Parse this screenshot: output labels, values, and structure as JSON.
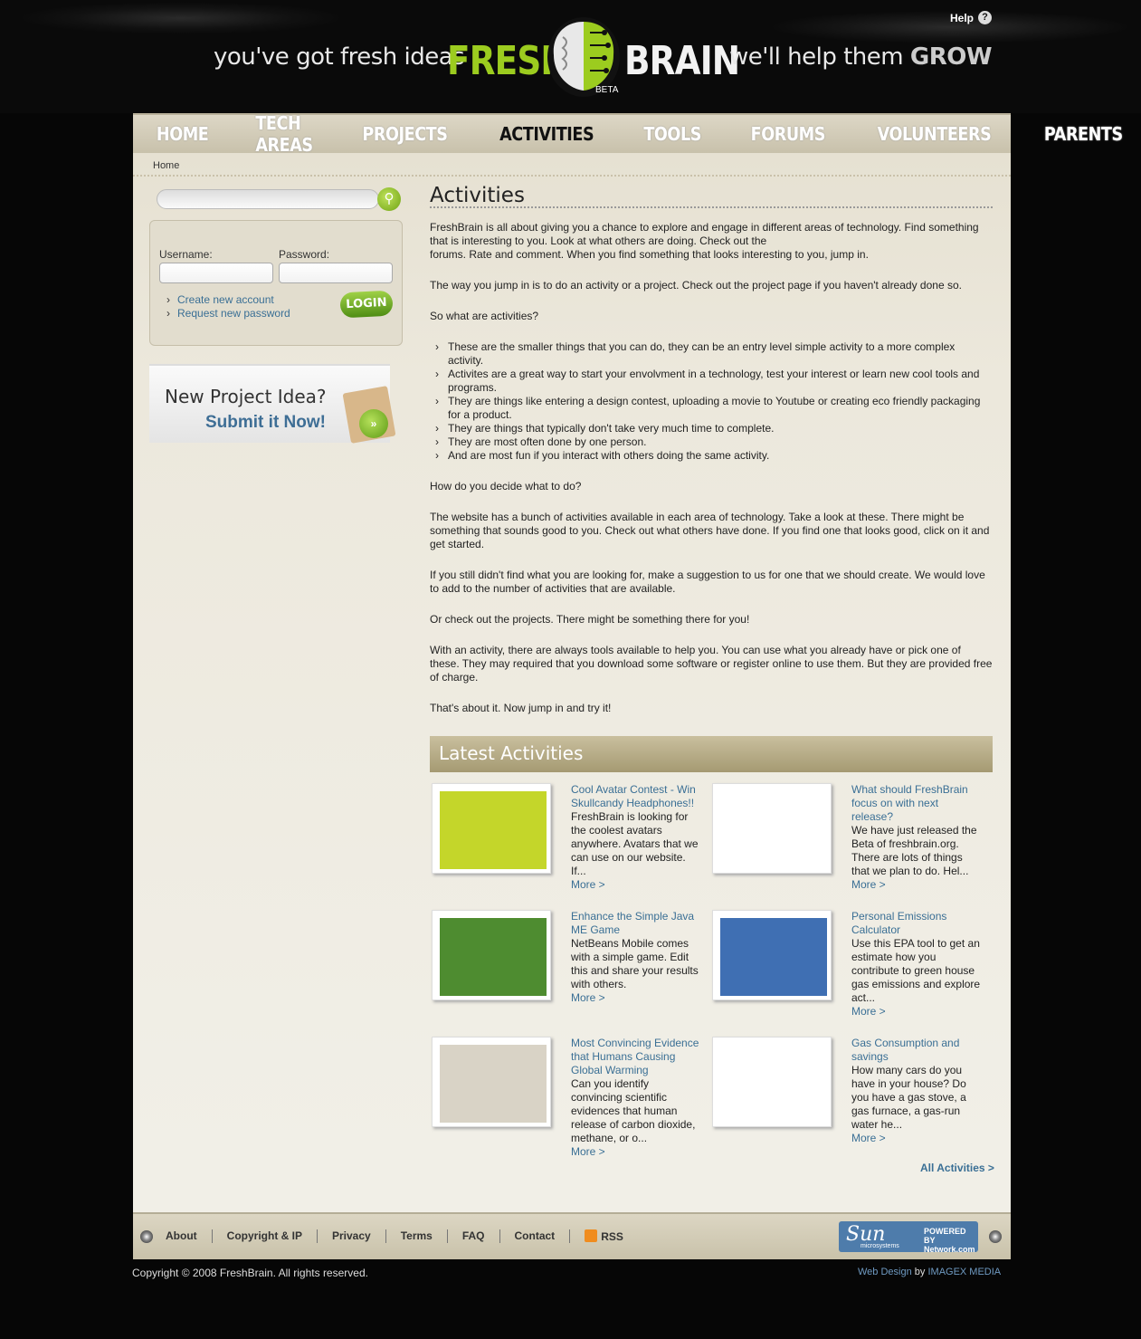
{
  "header": {
    "tagline_left": "you've got fresh ideas",
    "tagline_right": "we'll help them",
    "tagline_grow": "GROW",
    "logo_fresh": "FRESH",
    "logo_brain": "BRAIN",
    "logo_beta": "BETA",
    "help_label": "Help",
    "help_icon_glyph": "?"
  },
  "nav": {
    "items": [
      {
        "label": "HOME"
      },
      {
        "label": "TECH AREAS"
      },
      {
        "label": "PROJECTS"
      },
      {
        "label": "ACTIVITIES",
        "active": true
      },
      {
        "label": "TOOLS"
      },
      {
        "label": "FORUMS"
      },
      {
        "label": "VOLUNTEERS"
      },
      {
        "label": "PARENTS"
      }
    ]
  },
  "breadcrumb": "Home",
  "sidebar": {
    "search_icon": "magnifier-icon",
    "login": {
      "username_label": "Username:",
      "password_label": "Password:",
      "links": [
        "Create new account",
        "Request new password"
      ],
      "login_button": "LOGIN"
    },
    "idea": {
      "line1": "New Project Idea?",
      "line2": "Submit it Now!",
      "go_glyph": "»"
    }
  },
  "content": {
    "title": "Activities",
    "p1a": "FreshBrain is all about giving you a chance to explore and engage in different areas of technology. Find something that is interesting to you. Look at what others are doing. Check out the",
    "p1b": "forums. Rate and comment. When you find something that looks interesting to you, jump in.",
    "p2": "The way you jump in is to do an activity or a project. Check out the project page if you haven't already done so.",
    "p3": "So what are activities?",
    "bullets": [
      "These are the smaller things that you can do, they can be an entry level simple activity to a more complex activity.",
      "Activites are a great way to start your envolvment in a technology, test your interest or learn new cool tools and programs.",
      "They are things like entering a design contest, uploading a movie to Youtube or creating eco friendly packaging for a product.",
      "They are things that typically don't take very much time to complete.",
      "They are most often done by one person.",
      "And are most fun if you interact with others doing the same activity."
    ],
    "p4": "How do you decide what to do?",
    "p5": "The website has a bunch of activities available in each area of technology. Take a look at these. There might be something that sounds good to you. Check out what others have done. If you find one that looks good, click on it and get started.",
    "p6": "If you still didn't find what you are looking for, make a suggestion to us for one that we should create. We would love to add to the number of activities that are available.",
    "p7": "Or check out the projects. There might be something there for you!",
    "p8": "With an activity, there are always tools available to help you. You can use what you already have or pick one of these. They may required that you download some software or register online to use them. But they are provided free of charge.",
    "p9": "That's about it. Now jump in and try it!"
  },
  "latest": {
    "heading": "Latest Activities",
    "more_label": "More >",
    "all_label": "All Activities >",
    "cards": [
      {
        "title": "Cool Avatar Contest - Win Skullcandy Headphones!!",
        "desc": "FreshBrain is looking for the coolest avatars anywhere. Avatars that we can use on our website. If...",
        "thumb": "dj-avatar-image",
        "thumb_color": "#c4d62a"
      },
      {
        "title": "What should FreshBrain focus on with next release?",
        "desc": "We have just released the Beta of freshbrain.org. There are lots of things that we plan to do. Hel...",
        "thumb": "girl-thinking-image",
        "thumb_color": "#ffffff"
      },
      {
        "title": "Enhance the Simple Java ME Game",
        "desc": "NetBeans Mobile comes with a simple game. Edit this and share your results with others.",
        "thumb": "pixel-game-image",
        "thumb_color": "#4e8c30"
      },
      {
        "title": "Personal Emissions Calculator",
        "desc": "Use this EPA tool to get an estimate how you contribute to green house gas emissions and explore act...",
        "thumb": "cooling-towers-image",
        "thumb_color": "#3f6fb3"
      },
      {
        "title": "Most Convincing Evidence that Humans Causing Global Warming",
        "desc": "Can you identify convincing scientific evidences that human release of carbon dioxide, methane, or o...",
        "thumb": "newspaper-clippings-image",
        "thumb_color": "#d9d3c6"
      },
      {
        "title": "Gas Consumption and savings",
        "desc": "How many cars do you have in your house? Do you have a gas stove, a gas furnace, a gas-run water he...",
        "thumb": "fuel-nozzle-leaf-image",
        "thumb_color": "#ffffff"
      }
    ]
  },
  "footer": {
    "links": [
      "About",
      "Copyright & IP",
      "Privacy",
      "Terms",
      "FAQ",
      "Contact",
      "RSS"
    ],
    "sun_logo": "Sun",
    "sun_sub": "microsystems",
    "sun_powered": "POWERED BY",
    "sun_network": "Network.com",
    "copyright": "Copyright © 2008 FreshBrain. All rights reserved.",
    "credit_link": "Web Design",
    "credit_by": "by",
    "credit_company": "IMAGEX MEDIA"
  }
}
